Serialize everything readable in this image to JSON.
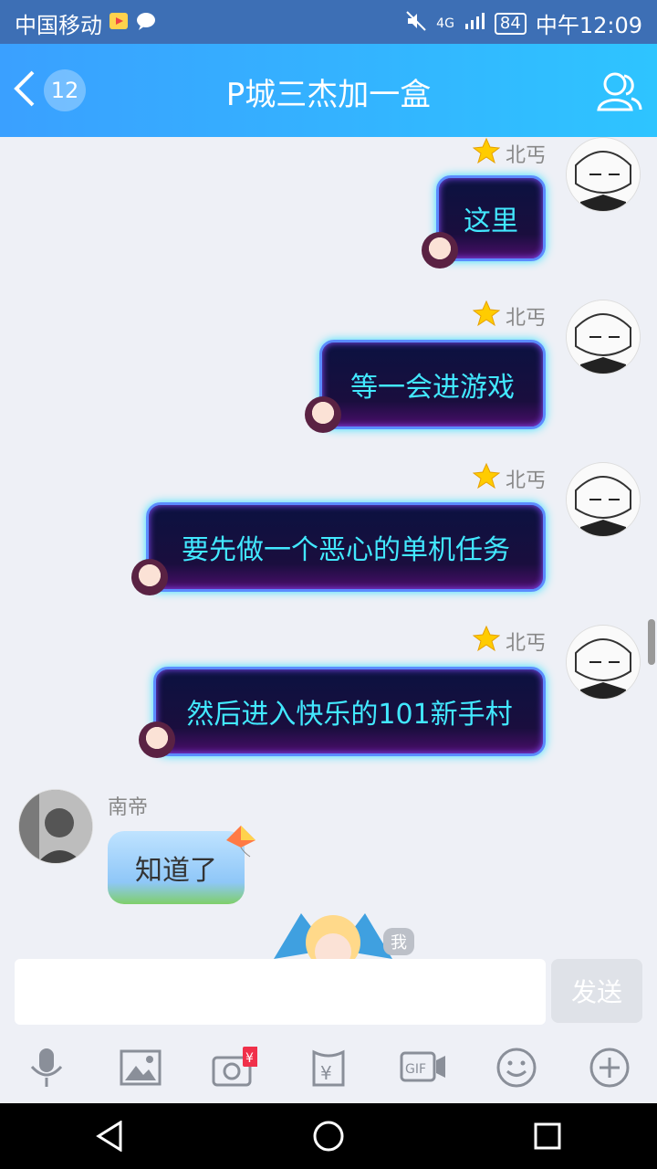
{
  "status_bar": {
    "carrier": "中国移动",
    "network": "4G",
    "battery": "84",
    "time": "中午12:09"
  },
  "header": {
    "back_count": "12",
    "title": "P城三杰加一盒"
  },
  "messages": [
    {
      "sender": "北丐",
      "text": "这里"
    },
    {
      "sender": "北丐",
      "text": "等一会进游戏"
    },
    {
      "sender": "北丐",
      "text": "要先做一个恶心的单机任务"
    },
    {
      "sender": "北丐",
      "text": "然后进入快乐的101新手村"
    },
    {
      "sender": "南帝",
      "text": "知道了"
    }
  ],
  "me_tag": "我",
  "input": {
    "placeholder": "",
    "send_label": "发送"
  },
  "toolbar": {
    "items": [
      "mic-icon",
      "image-icon",
      "red-packet-camera-icon",
      "money-icon",
      "gif-icon",
      "emoji-icon",
      "plus-icon"
    ]
  },
  "colors": {
    "header": "#2ec4ff",
    "bubble_text": "#42e8ff"
  }
}
